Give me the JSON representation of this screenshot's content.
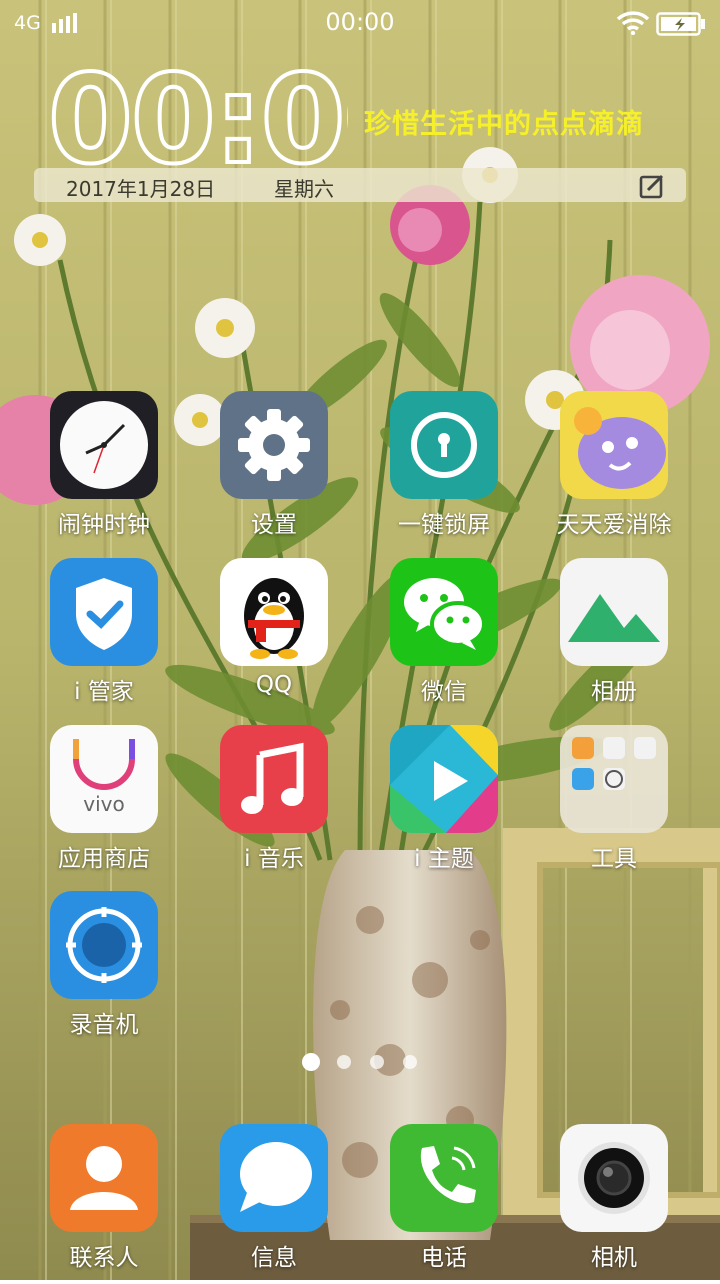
{
  "status_bar": {
    "network": "4G",
    "time": "00:00",
    "signal_icon": "signal-bars-icon",
    "wifi_icon": "wifi-icon",
    "battery_icon": "battery-charging-icon"
  },
  "clock_widget": {
    "time": "00:00",
    "motto": "珍惜生活中的点点滴滴",
    "date": "2017年1月28日",
    "weekday": "星期六",
    "edit_icon": "edit-note-icon",
    "motto_color": "#f6f02a"
  },
  "apps": [
    {
      "label": "闹钟时钟",
      "icon": "clock-icon"
    },
    {
      "label": "设置",
      "icon": "gear-icon"
    },
    {
      "label": "一键锁屏",
      "icon": "lock-screen-icon"
    },
    {
      "label": "天天爱消除",
      "icon": "game-icon"
    },
    {
      "label": "i 管家",
      "icon": "shield-check-icon"
    },
    {
      "label": "QQ",
      "icon": "qq-penguin-icon"
    },
    {
      "label": "微信",
      "icon": "wechat-icon"
    },
    {
      "label": "相册",
      "icon": "mountain-gallery-icon"
    },
    {
      "label": "应用商店",
      "icon": "vivo-store-icon",
      "brand_text": "vivo"
    },
    {
      "label": "i 音乐",
      "icon": "music-note-icon"
    },
    {
      "label": "i 主题",
      "icon": "theme-icon"
    },
    {
      "label": "工具",
      "icon": "tools-folder-icon"
    },
    {
      "label": "录音机",
      "icon": "recorder-icon"
    }
  ],
  "page_indicator": {
    "pages": 4,
    "current": 1
  },
  "dock": [
    {
      "label": "联系人",
      "icon": "contacts-icon"
    },
    {
      "label": "信息",
      "icon": "message-bubble-icon"
    },
    {
      "label": "电话",
      "icon": "phone-icon"
    },
    {
      "label": "相机",
      "icon": "camera-icon"
    }
  ]
}
